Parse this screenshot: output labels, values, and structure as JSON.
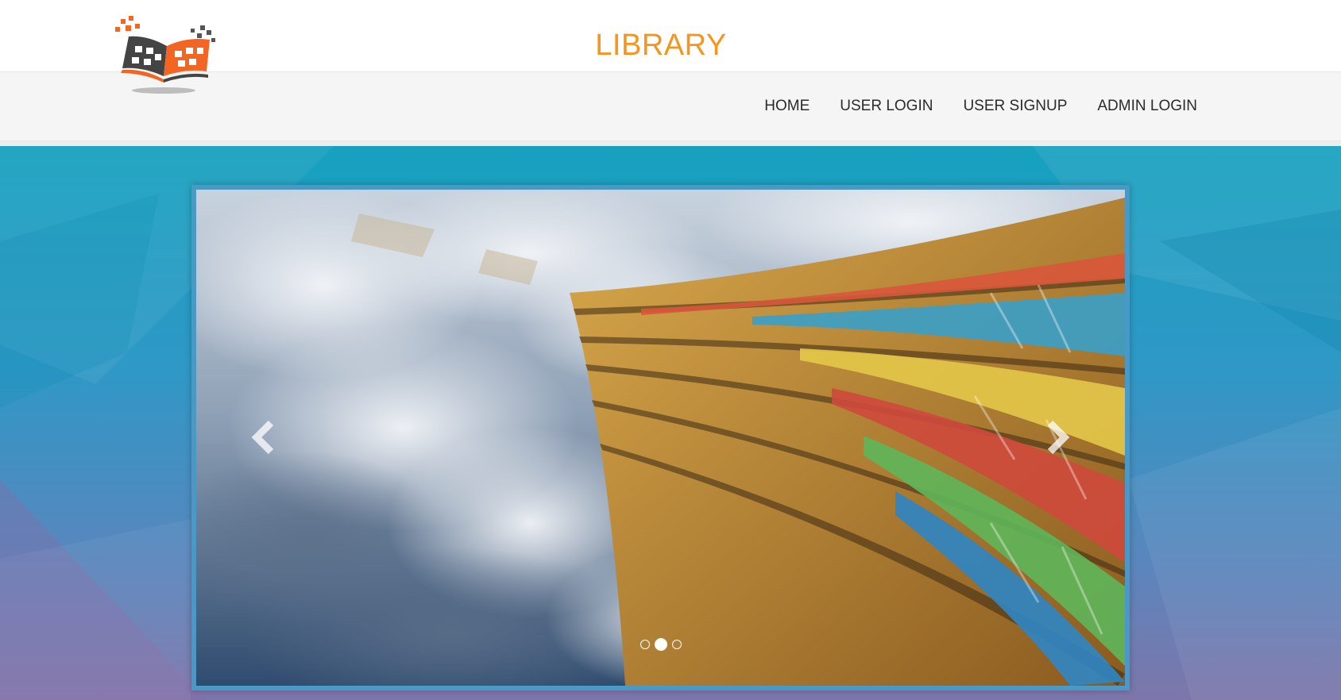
{
  "header": {
    "title": "LIBRARY",
    "title_color": "#f7941d",
    "logo_icon": "open-book-pixel-logo"
  },
  "nav": {
    "items": [
      {
        "label": "HOME"
      },
      {
        "label": "USER LOGIN"
      },
      {
        "label": "USER SIGNUP"
      },
      {
        "label": "ADMIN LOGIN"
      }
    ]
  },
  "carousel": {
    "image": "bookshelves-into-sky",
    "prev_icon": "chevron-left-icon",
    "next_icon": "chevron-right-icon",
    "slide_count": 3,
    "active_index": 1
  },
  "colors": {
    "accent": "#f7941d",
    "navbar_bg": "#f5f5f5",
    "hero_bg": "#2f98c6",
    "frame_border": "#4a98c6"
  }
}
